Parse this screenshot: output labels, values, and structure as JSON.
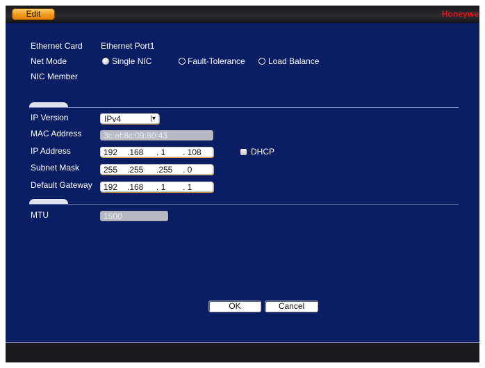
{
  "header": {
    "tab_label": "Edit",
    "brand": "Honeywell"
  },
  "network": {
    "ethernet_card_label": "Ethernet Card",
    "ethernet_card_value": "Ethernet Port1",
    "net_mode_label": "Net Mode",
    "net_mode_options": [
      {
        "label": "Single NIC",
        "selected": true
      },
      {
        "label": "Fault-Tolerance",
        "selected": false
      },
      {
        "label": "Load Balance",
        "selected": false
      }
    ],
    "nic_member_label": "NIC Member"
  },
  "ip": {
    "version_label": "IP Version",
    "version_value": "IPv4",
    "mac_label": "MAC Address",
    "mac_value": "3c:ef:8c:09:80:43",
    "address_label": "IP Address",
    "address": [
      "192",
      ".168",
      ". 1",
      ". 108"
    ],
    "dhcp_label": "DHCP",
    "dhcp_checked": false,
    "subnet_label": "Subnet Mask",
    "subnet": [
      "255",
      ".255",
      ".255",
      ". 0"
    ],
    "gateway_label": "Default Gateway",
    "gateway": [
      "192",
      ".168",
      ". 1",
      ". 1"
    ]
  },
  "mtu": {
    "label": "MTU",
    "value": "1500"
  },
  "buttons": {
    "ok": "OK",
    "cancel": "Cancel"
  },
  "colors": {
    "background": "#0b1e63",
    "tab_accent": "#f29a18",
    "brand": "#e0141e"
  }
}
